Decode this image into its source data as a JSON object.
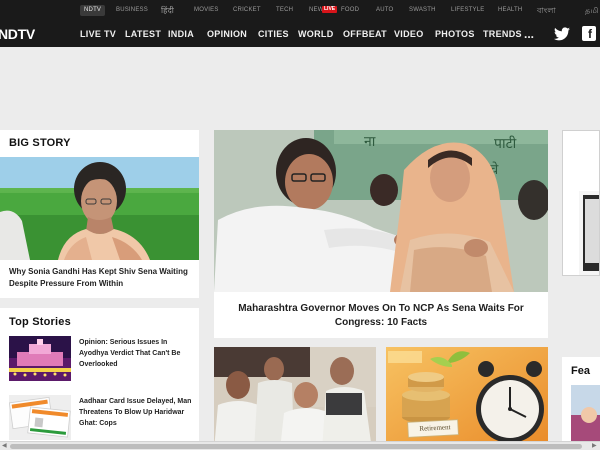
{
  "network_bar": {
    "items": [
      {
        "label": "NDTV",
        "active": true
      },
      {
        "label": "BUSINESS"
      },
      {
        "label": "हिंदी",
        "native": true
      },
      {
        "label": "MOVIES"
      },
      {
        "label": "CRICKET"
      },
      {
        "label": "TECH"
      },
      {
        "label": "NEW"
      },
      {
        "label": "FOOD"
      },
      {
        "label": "AUTO"
      },
      {
        "label": "SWASTH"
      },
      {
        "label": "LIFESTYLE"
      },
      {
        "label": "HEALTH"
      },
      {
        "label": "বাংলা",
        "native": true
      },
      {
        "label": "தமி",
        "native": true
      }
    ],
    "live_badge": "LIVE"
  },
  "main_nav": {
    "logo": "NDTV",
    "links": [
      "LIVE TV",
      "LATEST",
      "INDIA",
      "OPINION",
      "CITIES",
      "WORLD",
      "OFFBEAT",
      "VIDEO",
      "PHOTOS",
      "TRENDS"
    ],
    "more": "...",
    "icons": [
      "twitter-icon",
      "facebook-icon"
    ]
  },
  "big_story": {
    "section_title": "BIG STORY",
    "headline": "Why Sonia Gandhi Has Kept Shiv Sena Waiting Despite Pressure From Within"
  },
  "main_story": {
    "headline": "Maharashtra Governor Moves On To NCP As Sena Waits For Congress: 10 Facts"
  },
  "top_stories": {
    "section_title": "Top Stories",
    "items": [
      {
        "title": "Opinion: Serious Issues In Ayodhya Verdict That Can't Be Overlooked"
      },
      {
        "title": "Aadhaar Card Issue Delayed, Man Threatens To Blow Up Haridwar Ghat: Cops"
      }
    ]
  },
  "thumbnails": {
    "retirement_tag": "Retirement"
  },
  "right_column": {
    "featured_partial": "Fea"
  },
  "colors": {
    "nav_bg": "#1a1a1a",
    "live_red": "#d7141a",
    "page_bg": "#ececec"
  }
}
